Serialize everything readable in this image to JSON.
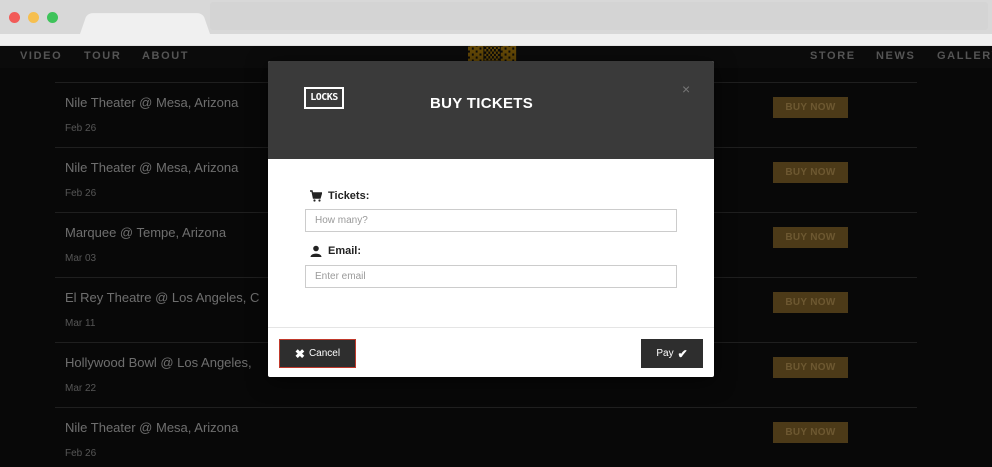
{
  "nav": {
    "left_links": [
      "VIDEO",
      "TOUR",
      "ABOUT"
    ],
    "right_links": [
      "STORE",
      "NEWS",
      "GALLERY"
    ],
    "brand": "Ib·K·I"
  },
  "events": [
    {
      "venue": "Nile Theater @ Mesa, Arizona",
      "date": "Feb 26",
      "button": "BUY NOW"
    },
    {
      "venue": "Nile Theater @ Mesa, Arizona",
      "date": "Feb 26",
      "button": "BUY NOW"
    },
    {
      "venue": "Marquee @ Tempe, Arizona",
      "date": "Mar 03",
      "button": "BUY NOW"
    },
    {
      "venue": "El Rey Theatre @ Los Angeles, C",
      "date": "Mar 11",
      "button": "BUY NOW"
    },
    {
      "venue": "Hollywood Bowl @ Los Angeles,",
      "date": "Mar 22",
      "button": "BUY NOW"
    },
    {
      "venue": "Nile Theater @ Mesa, Arizona",
      "date": "Feb 26",
      "button": "BUY NOW"
    }
  ],
  "modal": {
    "logo_text": "LOCKS",
    "title": "BUY TICKETS",
    "close": "×",
    "tickets_label": "Tickets:",
    "tickets_placeholder": "How many?",
    "email_label": "Email:",
    "email_placeholder": "Enter email",
    "cancel_label": "Cancel",
    "pay_label": "Pay"
  },
  "colors": {
    "page_bg": "#0f0f0f",
    "accent_gold": "#8a6a2c",
    "modal_header": "#3a3a3a",
    "cancel_border": "#c0392b"
  }
}
